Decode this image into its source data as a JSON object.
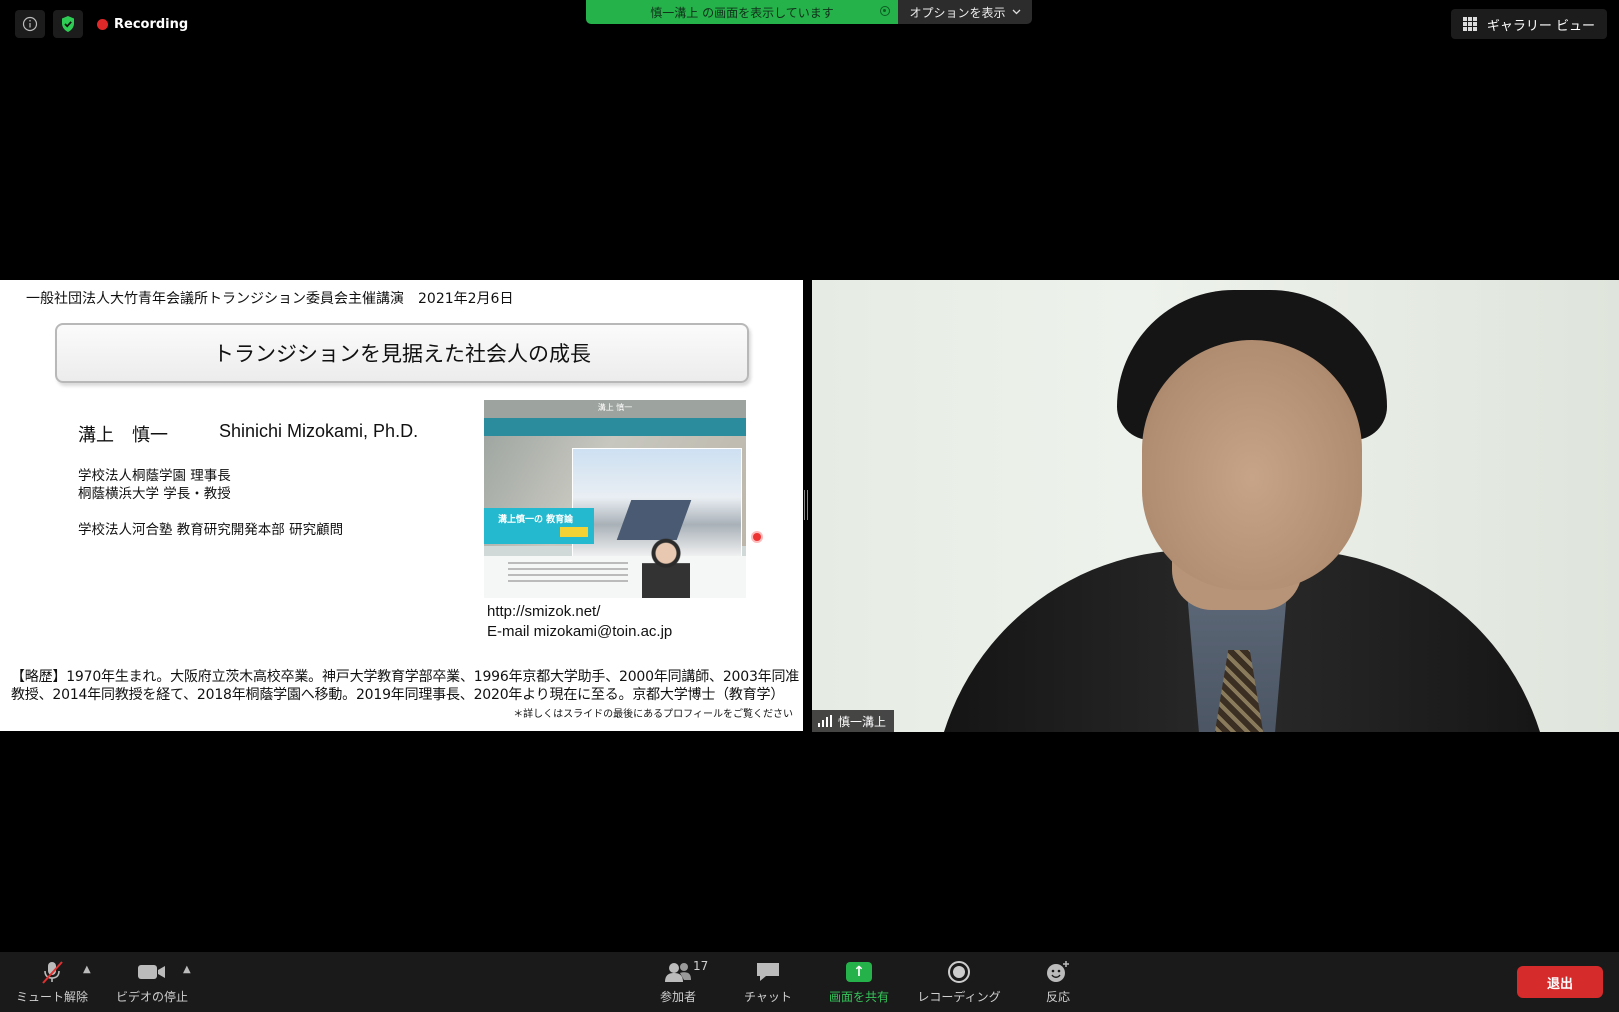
{
  "top": {
    "recording_label": "Recording",
    "share_banner": "慎一溝上 の画面を表示しています",
    "options_label": "オプションを表示",
    "gallery_label": "ギャラリー ビュー"
  },
  "slide": {
    "header": "一般社団法人大竹青年会議所トランジション委員会主催講演　2021年2月6日",
    "title": "トランジションを見据えた社会人の成長",
    "name_jp": "溝上　慎一",
    "name_en": "Shinichi Mizokami, Ph.D.",
    "affiliations": [
      "学校法人桐蔭学園 理事長",
      "桐蔭横浜大学 学長・教授",
      "学校法人河合塾 教育研究開発本部 研究顧問"
    ],
    "website_thumb_title": "溝上 慎一",
    "website_thumb_banner": "溝上慎一の 教育論",
    "url": "http://smizok.net/",
    "email": "E-mail  mizokami@toin.ac.jp",
    "bio": "【略歴】1970年生まれ。大阪府立茨木高校卒業。神戸大学教育学部卒業、1996年京都大学助手、2000年同講師、2003年同准教授、2014年同教授を経て、2018年桐蔭学園へ移動。2019年同理事長、2020年より現在に至る。京都大学博士（教育学）",
    "bio_note": "＊詳しくはスライドの最後にあるプロフィールをご覧ください"
  },
  "video": {
    "participant_name": "慎一溝上"
  },
  "toolbar": {
    "mute_label": "ミュート解除",
    "video_label": "ビデオの停止",
    "participants_label": "参加者",
    "participants_count": "17",
    "chat_label": "チャット",
    "share_label": "画面を共有",
    "record_label": "レコーディング",
    "reactions_label": "反応",
    "leave_label": "退出"
  },
  "colors": {
    "share_green": "#25b24a",
    "leave_red": "#d52b2b",
    "recording_red": "#e02828"
  }
}
